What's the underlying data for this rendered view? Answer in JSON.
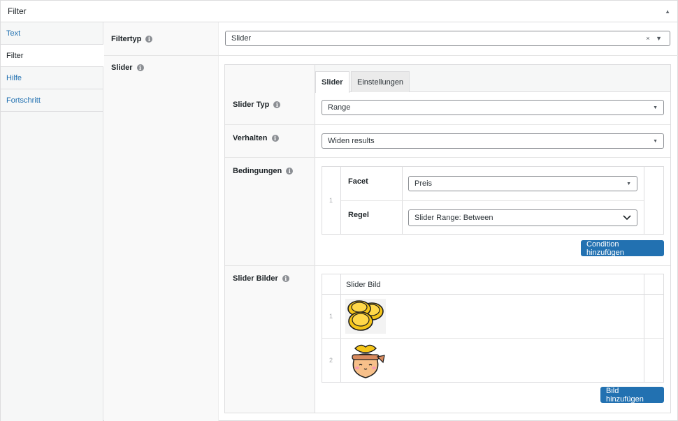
{
  "panel": {
    "title": "Filter"
  },
  "left_tabs": [
    {
      "label": "Text",
      "active": false
    },
    {
      "label": "Filter",
      "active": true
    },
    {
      "label": "Hilfe",
      "active": false
    },
    {
      "label": "Fortschritt",
      "active": false
    }
  ],
  "fields": {
    "filtertyp_label": "Filtertyp",
    "filtertyp_value": "Slider",
    "slider_label": "Slider"
  },
  "inner_tabs": {
    "slider": "Slider",
    "einstellungen": "Einstellungen"
  },
  "slider_typ": {
    "label": "Slider Typ",
    "value": "Range"
  },
  "verhalten": {
    "label": "Verhalten",
    "value": "Widen results"
  },
  "bedingungen": {
    "label": "Bedingungen",
    "row_number": "1",
    "facet_label": "Facet",
    "facet_value": "Preis",
    "regel_label": "Regel",
    "regel_value": "Slider Range: Between",
    "button": "Condition hinzufügen"
  },
  "slider_bilder": {
    "label": "Slider Bilder",
    "column_header": "Slider Bild",
    "rows": [
      {
        "number": "1",
        "image": "coins-image"
      },
      {
        "number": "2",
        "image": "money-bag-image"
      }
    ],
    "button": "Bild hinzufügen"
  },
  "colors": {
    "accent": "#2271b1",
    "coin": "#f5c518",
    "bag": "#f7c08a"
  }
}
